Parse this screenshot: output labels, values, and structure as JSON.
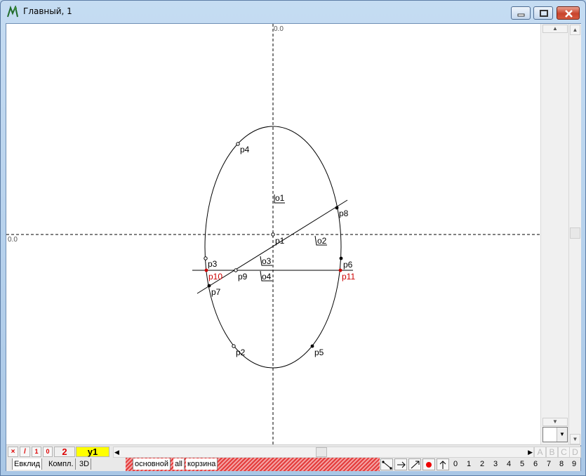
{
  "window": {
    "title": "Главный, 1"
  },
  "axes": {
    "x_origin_label": "0.0",
    "y_origin_label": "0.0"
  },
  "points": [
    {
      "name": "p1",
      "color": "#000"
    },
    {
      "name": "p2",
      "color": "#000"
    },
    {
      "name": "p3",
      "color": "#000"
    },
    {
      "name": "p4",
      "color": "#000"
    },
    {
      "name": "p5",
      "color": "#000"
    },
    {
      "name": "p6",
      "color": "#000"
    },
    {
      "name": "p7",
      "color": "#000"
    },
    {
      "name": "p8",
      "color": "#000"
    },
    {
      "name": "p9",
      "color": "#000"
    },
    {
      "name": "p10",
      "color": "#cc0000"
    },
    {
      "name": "p11",
      "color": "#cc0000"
    }
  ],
  "objects": [
    "o1",
    "o2",
    "o3",
    "o4"
  ],
  "toolbar": {
    "cross": "×",
    "slash": "/",
    "one": "1",
    "zero": "0",
    "count": "2",
    "current": "y1",
    "letters": [
      "A",
      "B",
      "C",
      "D"
    ]
  },
  "tabs_left": [
    "Евклид",
    "Компл.",
    "3D"
  ],
  "tabs_layers": [
    "основной",
    "all",
    "корзина"
  ],
  "digits": [
    "0",
    "1",
    "2",
    "3",
    "4",
    "5",
    "6",
    "7",
    "8",
    "9"
  ],
  "colors": {
    "accent_red": "#cc0000",
    "highlight": "#ffff00"
  }
}
